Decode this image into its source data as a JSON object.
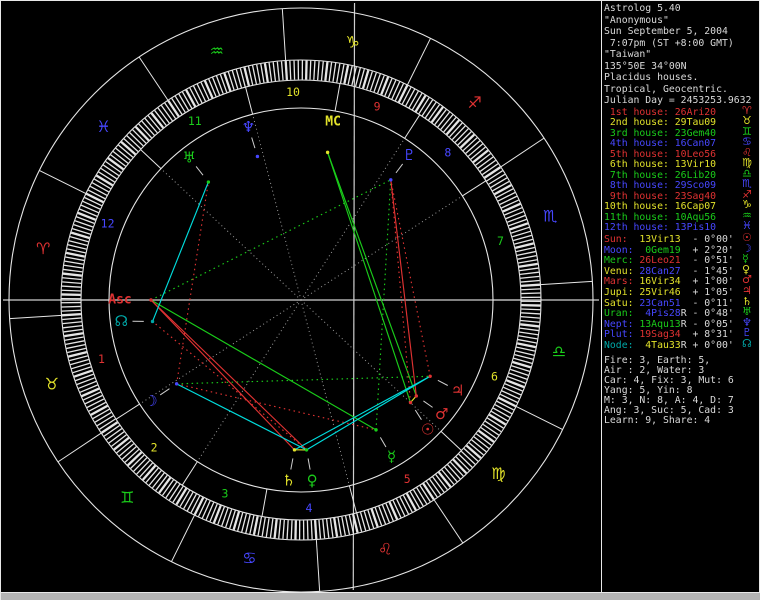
{
  "palette": {
    "red": "#df3232",
    "yellow": "#e2e22a",
    "green": "#1acc1a",
    "blue": "#4747ff",
    "dkcyan": "#00a8a8",
    "cyan": "#00dcdc",
    "white": "#d9d9d9",
    "line": "#e6e6e6",
    "dot": "#9c9c9c",
    "axis": "#cfcfcf",
    "fire": "#df3232",
    "earth": "#e2e22a",
    "air": "#1acc1a",
    "water": "#4747ff"
  },
  "panel": {
    "header_lines": [
      "Astrolog 5.40",
      "\"Anonymous\"",
      "Sun September 5, 2004",
      " 7:07pm (ST +8:00 GMT)",
      "\"Taiwan\"",
      "135°50E 34°00N",
      "Placidus houses.",
      "Tropical, Geocentric.",
      "Julian Day = 2453253.9632"
    ],
    "houses": {
      "rows": [
        {
          "label": " 1st house: ",
          "value": "26Ari20",
          "glyph": "♈",
          "element": "fire"
        },
        {
          "label": " 2nd house: ",
          "value": "29Tau09",
          "glyph": "♉",
          "element": "earth"
        },
        {
          "label": " 3rd house: ",
          "value": "23Gem40",
          "glyph": "♊",
          "element": "air"
        },
        {
          "label": " 4th house: ",
          "value": "16Can07",
          "glyph": "♋",
          "element": "water"
        },
        {
          "label": " 5th house: ",
          "value": "10Leo56",
          "glyph": "♌",
          "element": "fire"
        },
        {
          "label": " 6th house: ",
          "value": "13Vir10",
          "glyph": "♍",
          "element": "earth"
        },
        {
          "label": " 7th house: ",
          "value": "26Lib20",
          "glyph": "♎",
          "element": "air"
        },
        {
          "label": " 8th house: ",
          "value": "29Sco09",
          "glyph": "♏",
          "element": "water"
        },
        {
          "label": " 9th house: ",
          "value": "23Sag40",
          "glyph": "♐",
          "element": "fire"
        },
        {
          "label": "10th house: ",
          "value": "16Cap07",
          "glyph": "♑",
          "element": "earth"
        },
        {
          "label": "11th house: ",
          "value": "10Aqu56",
          "glyph": "♒",
          "element": "air"
        },
        {
          "label": "12th house: ",
          "value": "13Pis10",
          "glyph": "♓",
          "element": "water"
        }
      ]
    },
    "planets": {
      "rows": [
        {
          "label": "Sun:  ",
          "label_color": "red",
          "value": "13Vir13",
          "value_color": "earth",
          "retro": " ",
          "motion": " - 0°00'",
          "glyph": "☉",
          "glyph_color": "red"
        },
        {
          "label": "Moon: ",
          "label_color": "blue",
          "value": " 0Gem19",
          "value_color": "air",
          "retro": " ",
          "motion": " + 2°20'",
          "glyph": "☽",
          "glyph_color": "blue"
        },
        {
          "label": "Merc: ",
          "label_color": "green",
          "value": "26Leo21",
          "value_color": "fire",
          "retro": " ",
          "motion": " - 0°51'",
          "glyph": "☿",
          "glyph_color": "green"
        },
        {
          "label": "Venu: ",
          "label_color": "yellow",
          "value": "28Can27",
          "value_color": "water",
          "retro": " ",
          "motion": " - 1°45'",
          "glyph": "♀",
          "glyph_color": "yellow"
        },
        {
          "label": "Mars: ",
          "label_color": "red",
          "value": "16Vir34",
          "value_color": "earth",
          "retro": " ",
          "motion": " + 1°00'",
          "glyph": "♂",
          "glyph_color": "red"
        },
        {
          "label": "Jupi: ",
          "label_color": "yellow",
          "value": "25Vir46",
          "value_color": "earth",
          "retro": " ",
          "motion": " + 1°05'",
          "glyph": "♃",
          "glyph_color": "red"
        },
        {
          "label": "Satu: ",
          "label_color": "yellow",
          "value": "23Can51",
          "value_color": "water",
          "retro": " ",
          "motion": " - 0°11'",
          "glyph": "♄",
          "glyph_color": "yellow"
        },
        {
          "label": "Uran: ",
          "label_color": "green",
          "value": " 4Pis28",
          "value_color": "water",
          "retro": "R",
          "motion": " - 0°48'",
          "glyph": "♅",
          "glyph_color": "green"
        },
        {
          "label": "Nept: ",
          "label_color": "blue",
          "value": "13Aqu13",
          "value_color": "air",
          "retro": "R",
          "motion": " - 0°05'",
          "glyph": "♆",
          "glyph_color": "blue"
        },
        {
          "label": "Plut: ",
          "label_color": "blue",
          "value": "19Sag34",
          "value_color": "fire",
          "retro": " ",
          "motion": " + 8°31'",
          "glyph": "♇",
          "glyph_color": "blue"
        },
        {
          "label": "Node: ",
          "label_color": "dkcyan",
          "value": " 4Tau33",
          "value_color": "earth",
          "retro": "R",
          "motion": " + 0°00'",
          "glyph": "☊",
          "glyph_color": "dkcyan"
        }
      ]
    },
    "stats_lines": [
      "Fire: 3, Earth: 5,",
      "Air : 2, Water: 3",
      "Car: 4, Fix: 3, Mut: 6",
      "Yang: 5, Yin: 8",
      "M: 3, N: 8, A: 4, D: 7",
      "Ang: 3, Suc: 5, Cad: 3",
      "Learn: 9, Share: 4"
    ]
  },
  "wheel": {
    "ascendant_lon": 26.3333,
    "cusps": [
      26.3333,
      59.15,
      83.6667,
      106.1167,
      130.9333,
      163.1667,
      206.3333,
      239.15,
      263.6667,
      286.1167,
      310.9333,
      343.1667
    ],
    "house_number_colors": [
      "red",
      "yellow",
      "green",
      "blue",
      "red",
      "yellow",
      "green",
      "blue",
      "red",
      "yellow",
      "green",
      "blue"
    ],
    "signs": [
      {
        "name": "aries",
        "glyph": "♈",
        "element": "fire"
      },
      {
        "name": "taurus",
        "glyph": "♉",
        "element": "earth"
      },
      {
        "name": "gemini",
        "glyph": "♊",
        "element": "air"
      },
      {
        "name": "cancer",
        "glyph": "♋",
        "element": "water"
      },
      {
        "name": "leo",
        "glyph": "♌",
        "element": "fire"
      },
      {
        "name": "virgo",
        "glyph": "♍",
        "element": "earth"
      },
      {
        "name": "libra",
        "glyph": "♎",
        "element": "air"
      },
      {
        "name": "scorpio",
        "glyph": "♏",
        "element": "water"
      },
      {
        "name": "sagittarius",
        "glyph": "♐",
        "element": "fire"
      },
      {
        "name": "capricorn",
        "glyph": "♑",
        "element": "earth"
      },
      {
        "name": "aquarius",
        "glyph": "♒",
        "element": "air"
      },
      {
        "name": "pisces",
        "glyph": "♓",
        "element": "water"
      }
    ],
    "objects": [
      {
        "name": "sun",
        "glyph": "☉",
        "lon": 163.2167,
        "color": "red",
        "offset": -2.5,
        "is_text": false
      },
      {
        "name": "moon",
        "glyph": "☽",
        "lon": 60.3167,
        "color": "blue",
        "offset": 0,
        "is_text": false
      },
      {
        "name": "mercury",
        "glyph": "☿",
        "lon": 146.35,
        "color": "green",
        "offset": 0,
        "is_text": false
      },
      {
        "name": "venus",
        "glyph": "♀",
        "lon": 118.45,
        "color": "green",
        "offset": 1.4,
        "is_text": false
      },
      {
        "name": "mars",
        "glyph": "♂",
        "lon": 166.5667,
        "color": "red",
        "offset": 0.8,
        "is_text": false
      },
      {
        "name": "jupiter",
        "glyph": "♃",
        "lon": 175.7667,
        "color": "red",
        "offset": 0.5,
        "is_text": false
      },
      {
        "name": "saturn",
        "glyph": "♄",
        "lon": 113.85,
        "color": "yellow",
        "offset": -1.4,
        "is_text": false
      },
      {
        "name": "uranus",
        "glyph": "♅",
        "lon": 334.4667,
        "color": "green",
        "offset": 0,
        "is_text": false
      },
      {
        "name": "neptune",
        "glyph": "♆",
        "lon": 313.2167,
        "color": "blue",
        "offset": 0,
        "is_text": false
      },
      {
        "name": "pluto",
        "glyph": "♇",
        "lon": 259.5667,
        "color": "blue",
        "offset": 0,
        "is_text": false
      },
      {
        "name": "node",
        "glyph": "☊",
        "lon": 34.55,
        "color": "dkcyan",
        "offset": -1.5,
        "is_text": false
      },
      {
        "name": "asc",
        "glyph": "Asc",
        "lon": 26.3333,
        "color": "red",
        "offset": 0,
        "is_text": true
      },
      {
        "name": "mc",
        "glyph": "MC",
        "lon": 286.1167,
        "color": "yellow",
        "offset": 0,
        "is_text": true
      }
    ],
    "aspects": [
      {
        "a": "mc",
        "b": "sun",
        "type": "trine",
        "color": "green",
        "dotted": false
      },
      {
        "a": "mc",
        "b": "mars",
        "type": "trine",
        "color": "green",
        "dotted": false
      },
      {
        "a": "asc",
        "b": "mercury",
        "type": "trine",
        "color": "green",
        "dotted": false
      },
      {
        "a": "moon",
        "b": "jupiter",
        "type": "trine",
        "color": "green",
        "dotted": true
      },
      {
        "a": "asc",
        "b": "pluto",
        "type": "trine",
        "color": "green",
        "dotted": true
      },
      {
        "a": "mercury",
        "b": "pluto",
        "type": "trine",
        "color": "green",
        "dotted": true
      },
      {
        "a": "asc",
        "b": "saturn",
        "type": "square",
        "color": "red",
        "dotted": false
      },
      {
        "a": "asc",
        "b": "venus",
        "type": "square",
        "color": "red",
        "dotted": false
      },
      {
        "a": "mars",
        "b": "pluto",
        "type": "square",
        "color": "red",
        "dotted": false
      },
      {
        "a": "sun",
        "b": "pluto",
        "type": "square",
        "color": "red",
        "dotted": true
      },
      {
        "a": "jupiter",
        "b": "pluto",
        "type": "square",
        "color": "red",
        "dotted": true
      },
      {
        "a": "moon",
        "b": "mercury",
        "type": "square",
        "color": "red",
        "dotted": true
      },
      {
        "a": "moon",
        "b": "uranus",
        "type": "square",
        "color": "red",
        "dotted": true
      },
      {
        "a": "venus",
        "b": "node",
        "type": "square",
        "color": "red",
        "dotted": true
      },
      {
        "a": "sun",
        "b": "mars",
        "type": "conjunction",
        "color": "yellow",
        "dotted": false
      },
      {
        "a": "venus",
        "b": "saturn",
        "type": "conjunction",
        "color": "yellow",
        "dotted": false
      },
      {
        "a": "moon",
        "b": "venus",
        "type": "sextile",
        "color": "cyan",
        "dotted": false
      },
      {
        "a": "jupiter",
        "b": "saturn",
        "type": "sextile",
        "color": "cyan",
        "dotted": false
      },
      {
        "a": "venus",
        "b": "jupiter",
        "type": "sextile",
        "color": "cyan",
        "dotted": false
      },
      {
        "a": "uranus",
        "b": "node",
        "type": "sextile",
        "color": "cyan",
        "dotted": false
      }
    ]
  }
}
